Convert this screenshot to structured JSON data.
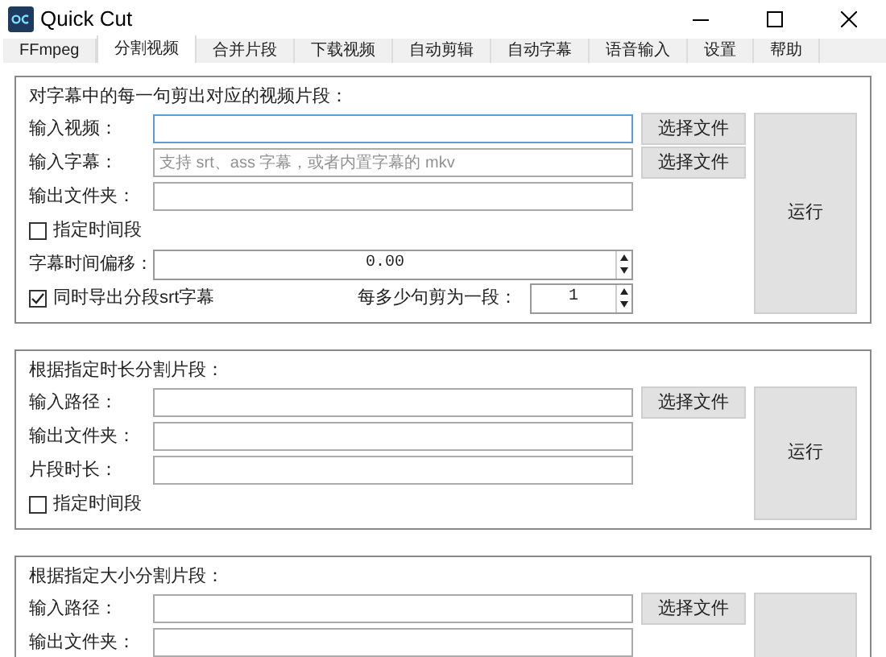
{
  "window": {
    "title": "Quick Cut"
  },
  "tabs": [
    {
      "label": "FFmpeg",
      "selected": false
    },
    {
      "label": "分割视频",
      "selected": true
    },
    {
      "label": "合并片段",
      "selected": false
    },
    {
      "label": "下载视频",
      "selected": false
    },
    {
      "label": "自动剪辑",
      "selected": false
    },
    {
      "label": "自动字幕",
      "selected": false
    },
    {
      "label": "语音输入",
      "selected": false
    },
    {
      "label": "设置",
      "selected": false
    },
    {
      "label": "帮助",
      "selected": false
    }
  ],
  "panels": [
    {
      "title": "对字幕中的每一句剪出对应的视频片段：",
      "run_button": "运行",
      "rows": [
        {
          "kind": "field",
          "label": "输入视频：",
          "focused": true,
          "button": "选择文件"
        },
        {
          "kind": "field",
          "label": "输入字幕：",
          "placeholder": "支持 srt、ass 字幕，或者内置字幕的 mkv",
          "button": "选择文件"
        },
        {
          "kind": "field",
          "label": "输出文件夹："
        },
        {
          "kind": "checkbox",
          "label": "指定时间段",
          "checked": false
        },
        {
          "kind": "spin",
          "label": "字幕时间偏移：",
          "value": "0.00"
        },
        {
          "kind": "check_spin",
          "label": "同时导出分段srt字幕",
          "checked": true,
          "spin_label": "每多少句剪为一段：",
          "value": "1"
        }
      ]
    },
    {
      "title": "根据指定时长分割片段：",
      "run_button": "运行",
      "rows": [
        {
          "kind": "field",
          "label": "输入路径：",
          "button": "选择文件"
        },
        {
          "kind": "field",
          "label": "输出文件夹："
        },
        {
          "kind": "field",
          "label": "片段时长："
        },
        {
          "kind": "checkbox",
          "label": "指定时间段",
          "checked": false
        }
      ]
    },
    {
      "title": "根据指定大小分割片段：",
      "rows": [
        {
          "kind": "field",
          "label": "输入路径：",
          "button": "选择文件"
        },
        {
          "kind": "field",
          "label": "输出文件夹："
        }
      ]
    }
  ]
}
